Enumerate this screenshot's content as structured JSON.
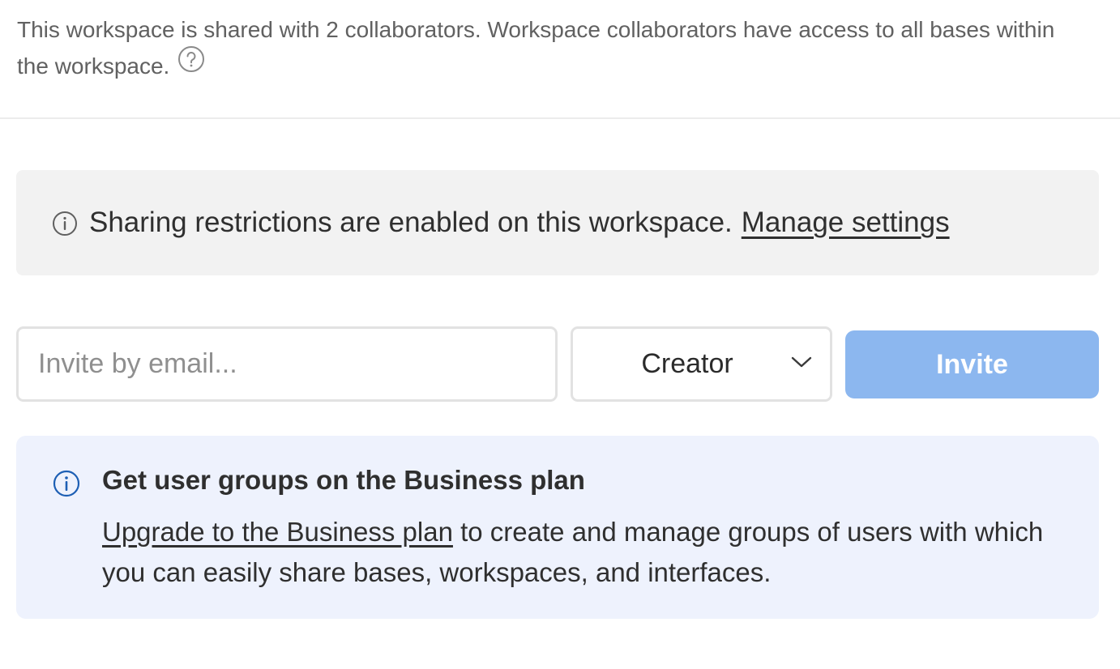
{
  "workspace": {
    "description": "This workspace is shared with 2 collaborators. Workspace collaborators have access to all bases within the workspace.",
    "help_icon": "question-circle-icon"
  },
  "restriction_banner": {
    "icon": "info-icon",
    "text": "Sharing restrictions are enabled on this workspace.",
    "link_label": "Manage settings"
  },
  "invite": {
    "email_placeholder": "Invite by email...",
    "email_value": "",
    "role_selected": "Creator",
    "button_label": "Invite",
    "button_color": "#8cb7ef"
  },
  "promo": {
    "icon": "info-icon",
    "icon_color": "#1d5fb4",
    "title": "Get user groups on the Business plan",
    "link_label": "Upgrade to the Business plan",
    "body": " to create and manage groups of users with which you can easily share bases, workspaces, and interfaces.",
    "background": "#eef2fd"
  }
}
